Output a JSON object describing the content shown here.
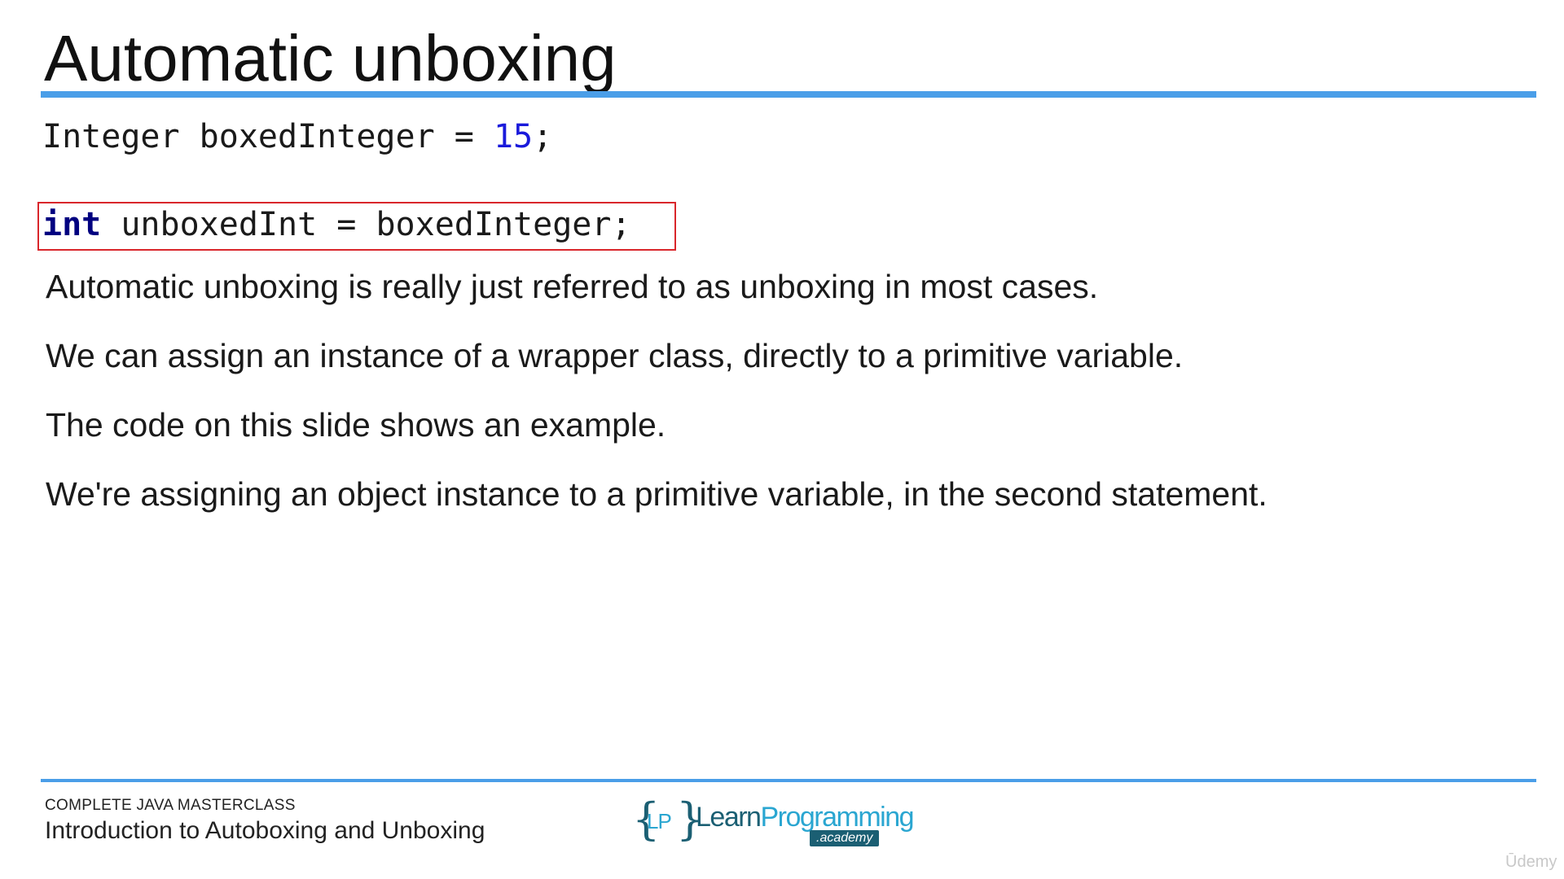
{
  "slide": {
    "title": "Automatic unboxing"
  },
  "code": {
    "line1": {
      "type": "Integer",
      "name": "boxedInteger",
      "op": "=",
      "value": "15",
      "end": ";"
    },
    "line2": {
      "keyword": "int",
      "name": "unboxedInt",
      "op": "=",
      "value": "boxedInteger",
      "end": ";"
    }
  },
  "paragraphs": [
    "Automatic unboxing is really just referred to as unboxing in most cases.",
    "We can assign an instance of a wrapper class, directly to a primitive variable.",
    "The code on this slide shows an example.",
    "We're assigning an object instance to a primitive variable, in the second statement."
  ],
  "footer": {
    "course": "COMPLETE JAVA MASTERCLASS",
    "lecture": "Introduction to Autoboxing and Unboxing",
    "logo": {
      "brace_open": "{",
      "initials": "LP",
      "brace_close": "}",
      "learn": "Learn",
      "programming": "Programming",
      "academy": ".academy"
    },
    "watermark": "Ūdemy"
  },
  "colors": {
    "accent_rule": "#4a9ee8",
    "highlight_box": "#d9262b",
    "keyword": "#000080",
    "number": "#1a1adb"
  }
}
